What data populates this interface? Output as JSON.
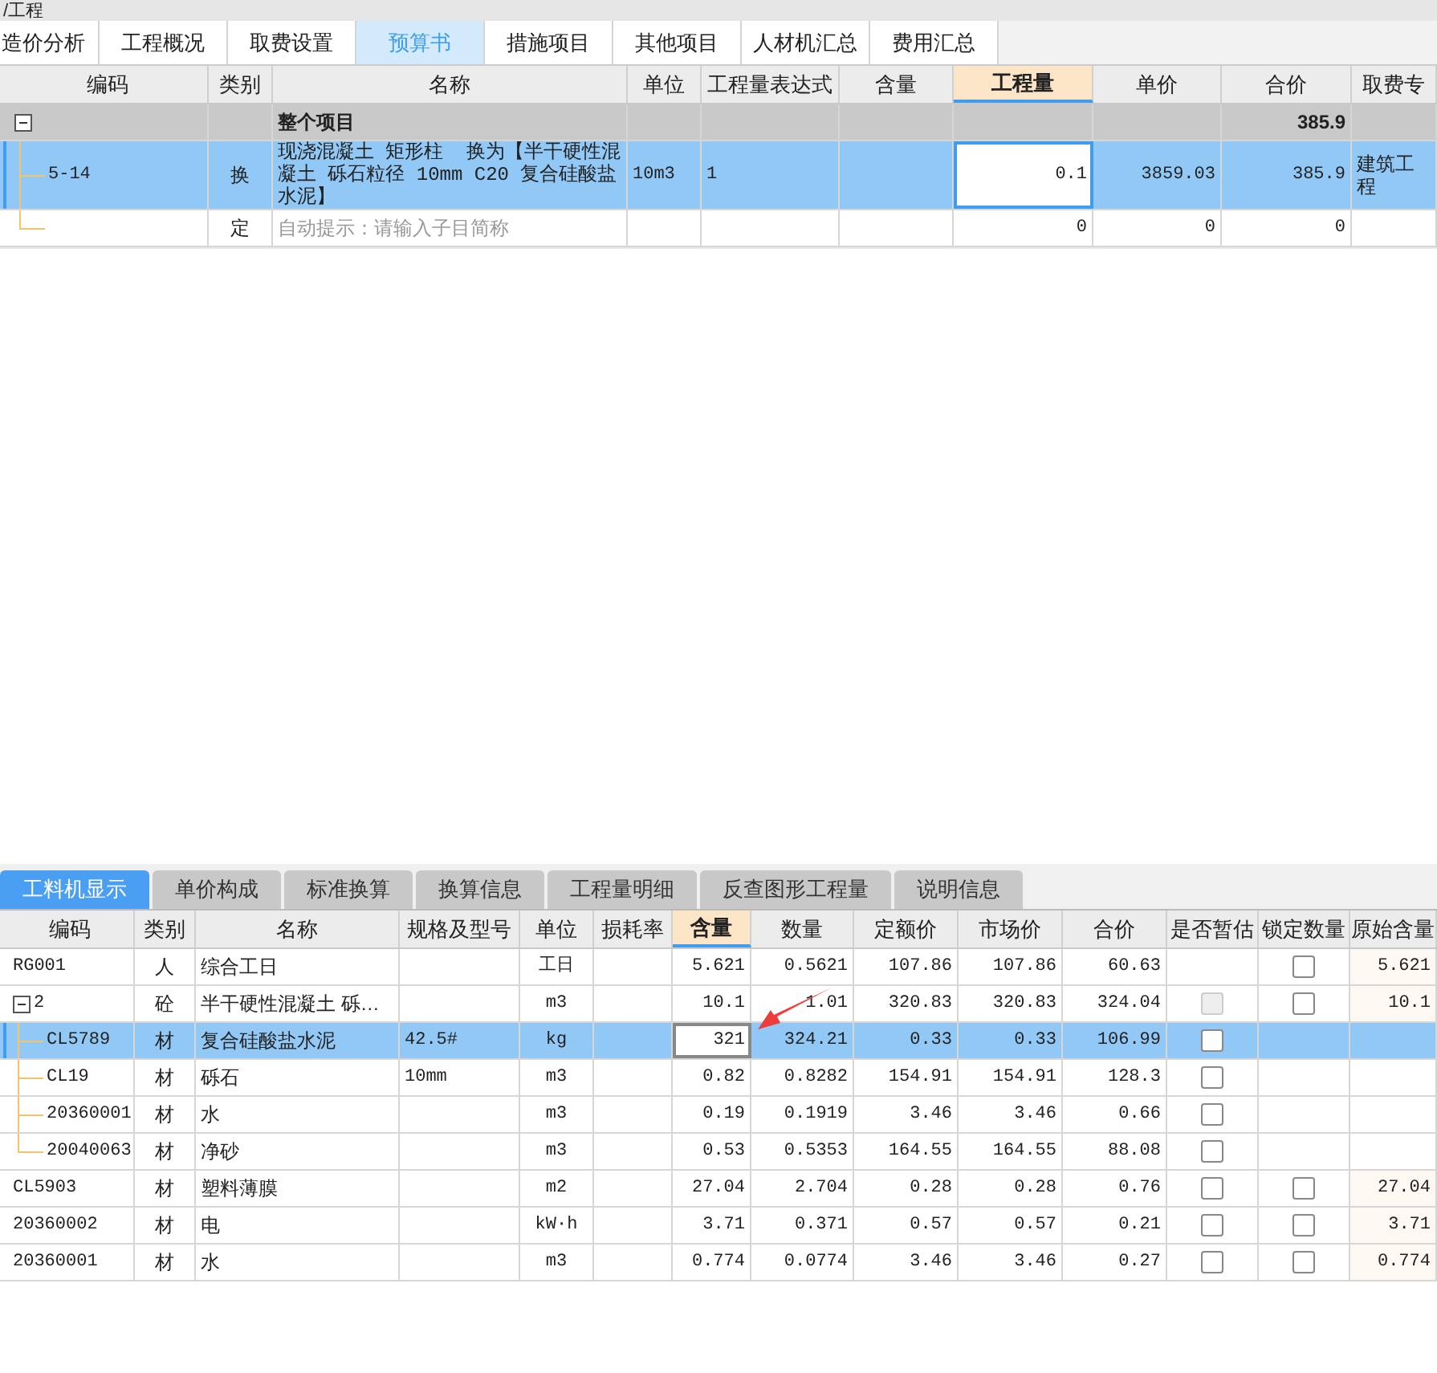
{
  "window": {
    "title": "/工程"
  },
  "tabs": [
    {
      "label": "造价分析",
      "selected": false
    },
    {
      "label": "工程概况",
      "selected": false
    },
    {
      "label": "取费设置",
      "selected": false
    },
    {
      "label": "预算书",
      "selected": true
    },
    {
      "label": "措施项目",
      "selected": false
    },
    {
      "label": "其他项目",
      "selected": false
    },
    {
      "label": "人材机汇总",
      "selected": false
    },
    {
      "label": "费用汇总",
      "selected": false
    }
  ],
  "budget": {
    "columns": [
      {
        "label": "编码",
        "highlighted": false
      },
      {
        "label": "类别",
        "highlighted": false
      },
      {
        "label": "名称",
        "highlighted": false
      },
      {
        "label": "单位",
        "highlighted": false
      },
      {
        "label": "工程量表达式",
        "highlighted": false
      },
      {
        "label": "含量",
        "highlighted": false
      },
      {
        "label": "工程量",
        "highlighted": true
      },
      {
        "label": "单价",
        "highlighted": false
      },
      {
        "label": "合价",
        "highlighted": false
      },
      {
        "label": "取费专",
        "highlighted": false
      }
    ],
    "rows": [
      {
        "name": "整个项目",
        "total": "385.9",
        "expanded": true,
        "selected": false,
        "children": [
          {
            "code": "5-14",
            "type": "换",
            "name": "现浇混凝土 矩形柱  换为【半干硬性混凝土 砾石粒径 10mm C20 复合硅酸盐水泥】",
            "unit": "10m3",
            "expr": "1",
            "qty": "0.1",
            "price": "3859.03",
            "total": "385.9",
            "fee": "建筑工程",
            "selected": true
          },
          {
            "type": "定",
            "placeholder": "自动提示：请输入子目简称",
            "qty": "0",
            "price": "0",
            "total": "0",
            "selected": false
          }
        ]
      }
    ]
  },
  "detail_tabs": [
    {
      "label": "工料机显示",
      "selected": true
    },
    {
      "label": "单价构成",
      "selected": false
    },
    {
      "label": "标准换算",
      "selected": false
    },
    {
      "label": "换算信息",
      "selected": false
    },
    {
      "label": "工程量明细",
      "selected": false
    },
    {
      "label": "反查图形工程量",
      "selected": false
    },
    {
      "label": "说明信息",
      "selected": false
    }
  ],
  "resources": {
    "columns": [
      {
        "label": "编码",
        "highlighted": false
      },
      {
        "label": "类别",
        "highlighted": false
      },
      {
        "label": "名称",
        "highlighted": false
      },
      {
        "label": "规格及型号",
        "highlighted": false
      },
      {
        "label": "单位",
        "highlighted": false
      },
      {
        "label": "损耗率",
        "highlighted": false
      },
      {
        "label": "含量",
        "highlighted": true
      },
      {
        "label": "数量",
        "highlighted": false
      },
      {
        "label": "定额价",
        "highlighted": false
      },
      {
        "label": "市场价",
        "highlighted": false
      },
      {
        "label": "合价",
        "highlighted": false
      },
      {
        "label": "是否暂估",
        "highlighted": false
      },
      {
        "label": "锁定数量",
        "highlighted": false
      },
      {
        "label": "原始含量",
        "highlighted": false
      }
    ],
    "rows": [
      {
        "code": "RG001",
        "type": "人",
        "name": "综合工日",
        "unit": "工日",
        "content": "5.621",
        "qty": "0.5621",
        "base_price": "107.86",
        "market_price": "107.86",
        "total": "60.63",
        "lock": {
          "checked": false
        },
        "original": "5.621",
        "selected": false
      },
      {
        "code": "2",
        "type": "砼",
        "name": "半干硬性混凝土 砾…",
        "unit": "m3",
        "content": "10.1",
        "qty": "1.01",
        "base_price": "320.83",
        "market_price": "320.83",
        "total": "324.04",
        "estimate": {
          "checked": false,
          "disabled": true
        },
        "lock": {
          "checked": false
        },
        "original": "10.1",
        "expanded": true,
        "selected": false,
        "children": [
          {
            "code": "CL5789",
            "type": "材",
            "name": "复合硅酸盐水泥",
            "spec": "42.5#",
            "unit": "kg",
            "content": "321",
            "qty": "324.21",
            "base_price": "0.33",
            "market_price": "0.33",
            "total": "106.99",
            "estimate": {
              "checked": false,
              "disabled": false
            },
            "selected": true
          },
          {
            "code": "CL19",
            "type": "材",
            "name": "砾石",
            "spec": "10mm",
            "unit": "m3",
            "content": "0.82",
            "qty": "0.8282",
            "base_price": "154.91",
            "market_price": "154.91",
            "total": "128.3",
            "estimate": {
              "checked": false,
              "disabled": false
            },
            "selected": false
          },
          {
            "code": "20360001",
            "type": "材",
            "name": "水",
            "unit": "m3",
            "content": "0.19",
            "qty": "0.1919",
            "base_price": "3.46",
            "market_price": "3.46",
            "total": "0.66",
            "estimate": {
              "checked": false,
              "disabled": false
            },
            "selected": false
          },
          {
            "code": "20040063",
            "type": "材",
            "name": "净砂",
            "unit": "m3",
            "content": "0.53",
            "qty": "0.5353",
            "base_price": "164.55",
            "market_price": "164.55",
            "total": "88.08",
            "estimate": {
              "checked": false,
              "disabled": false
            },
            "selected": false
          }
        ]
      },
      {
        "code": "CL5903",
        "type": "材",
        "name": "塑料薄膜",
        "unit": "m2",
        "content": "27.04",
        "qty": "2.704",
        "base_price": "0.28",
        "market_price": "0.28",
        "total": "0.76",
        "estimate": {
          "checked": false,
          "disabled": false
        },
        "lock": {
          "checked": false
        },
        "original": "27.04",
        "selected": false
      },
      {
        "code": "20360002",
        "type": "材",
        "name": "电",
        "unit": "kW·h",
        "content": "3.71",
        "qty": "0.371",
        "base_price": "0.57",
        "market_price": "0.57",
        "total": "0.21",
        "estimate": {
          "checked": false,
          "disabled": false
        },
        "lock": {
          "checked": false
        },
        "original": "3.71",
        "selected": false
      },
      {
        "code": "20360001",
        "type": "材",
        "name": "水",
        "unit": "m3",
        "content": "0.774",
        "qty": "0.0774",
        "base_price": "3.46",
        "market_price": "3.46",
        "total": "0.27",
        "estimate": {
          "checked": false,
          "disabled": false
        },
        "lock": {
          "checked": false
        },
        "original": "0.774",
        "selected": false
      }
    ]
  }
}
